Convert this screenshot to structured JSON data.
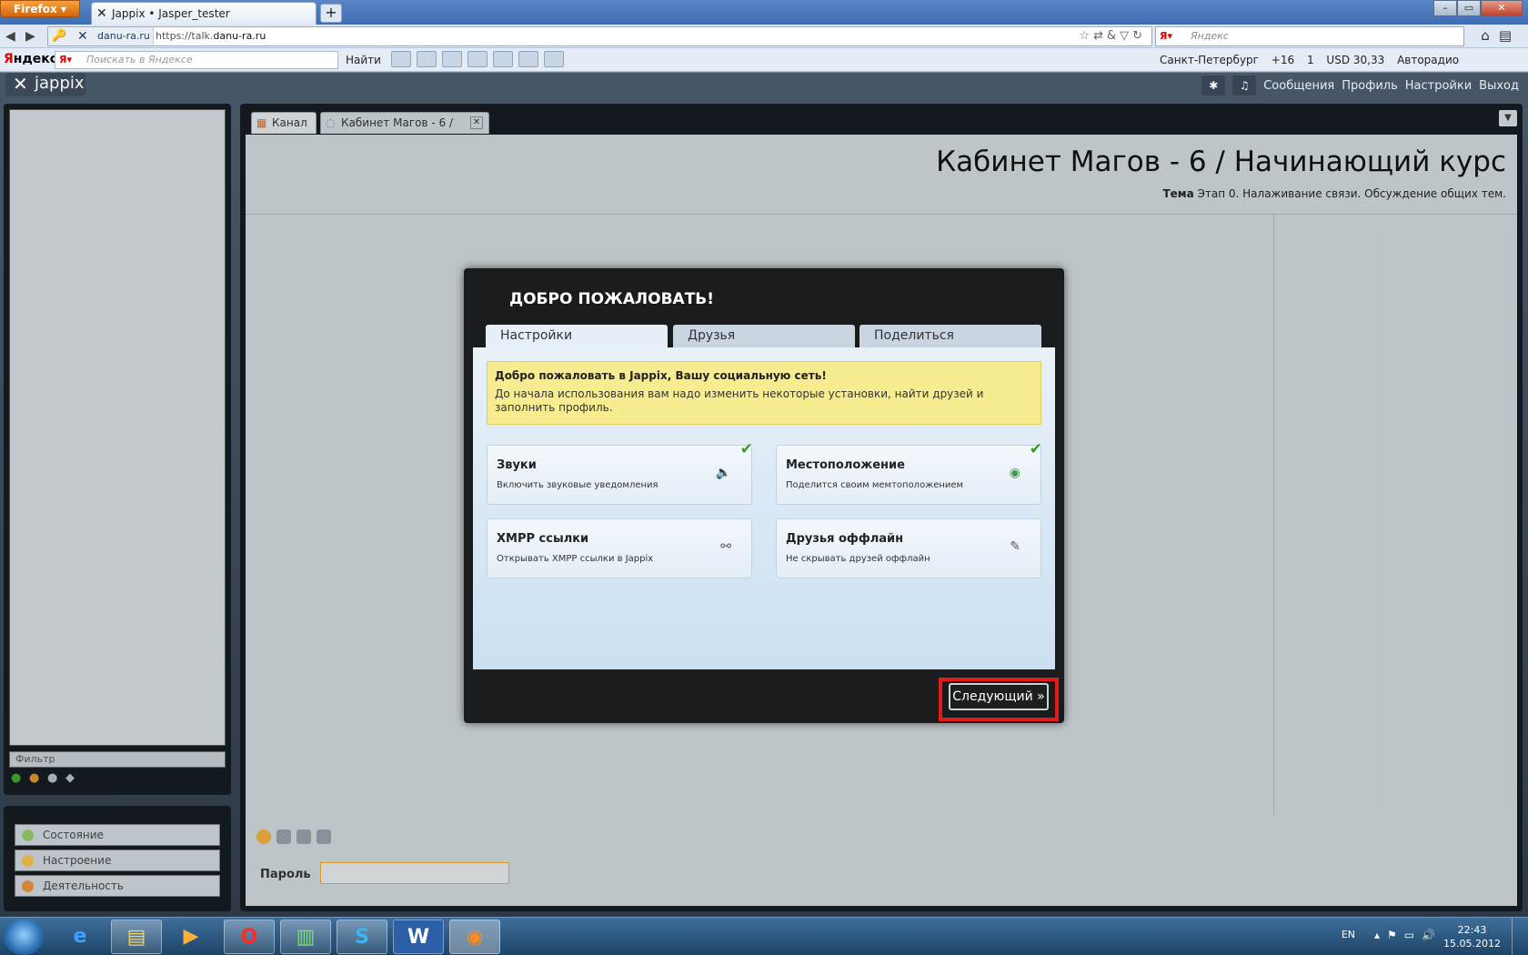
{
  "browser": {
    "menu_button": "Firefox",
    "tab_title": "Jappix • Jasper_tester",
    "new_tab": "+",
    "identity": "danu-ra.ru",
    "url_prefix": "https://talk.",
    "url_domain": "danu-ra.ru",
    "search_placeholder": "Яндекс"
  },
  "yandex_bar": {
    "logo_prefix": "Я",
    "logo_suffix": "ндекс",
    "search_placeholder": "Поискать в Яндексе",
    "find_label": "Найти",
    "city": "Санкт-Петербург",
    "weather": "+16",
    "mail_count": "1",
    "currency": "USD 30,33",
    "radio": "Авторадио"
  },
  "jappix": {
    "logo": "jappix",
    "nav": [
      "Сообщения",
      "Профиль",
      "Настройки",
      "Выход"
    ],
    "roster_filter_placeholder": "Фильтр",
    "presence": [
      "Состояние",
      "Настроение",
      "Деятельность"
    ],
    "tabs": [
      {
        "label": "Канал"
      },
      {
        "label": "Кабинет Магов - 6 /"
      }
    ],
    "chat": {
      "title": "Кабинет Магов - 6 / Начинающий курс",
      "topic_label": "Тема",
      "topic_text": "Этап 0. Налаживание связи. Обсуждение общих тем.",
      "password_label": "Пароль"
    }
  },
  "modal": {
    "title": "ДОБРО ПОЖАЛОВАТЬ!",
    "tabs": [
      "Настройки",
      "Друзья",
      "Поделиться"
    ],
    "welcome_heading": "Добро пожаловать в Jappix, Вашу социальную сеть!",
    "welcome_text": "До начала использования вам надо изменить некоторые установки, найти друзей и заполнить профиль.",
    "options": [
      {
        "title": "Звуки",
        "desc": "Включить звуковые уведомления",
        "icon": "speaker-icon",
        "checked": true
      },
      {
        "title": "Местоположение",
        "desc": "Поделится своим мемтоположением",
        "icon": "globe-icon",
        "checked": true
      },
      {
        "title": "XMPP ссылки",
        "desc": "Открывать XMPP ссылки в Jappix",
        "icon": "link-icon",
        "checked": false
      },
      {
        "title": "Друзья оффлайн",
        "desc": "Не скрывать друзей оффлайн",
        "icon": "paperclip-icon",
        "checked": false
      }
    ],
    "next_label": "Следующий »",
    "highlight_color": "#e31b1b"
  },
  "taskbar": {
    "lang": "EN",
    "time": "22:43",
    "date": "15.05.2012"
  }
}
